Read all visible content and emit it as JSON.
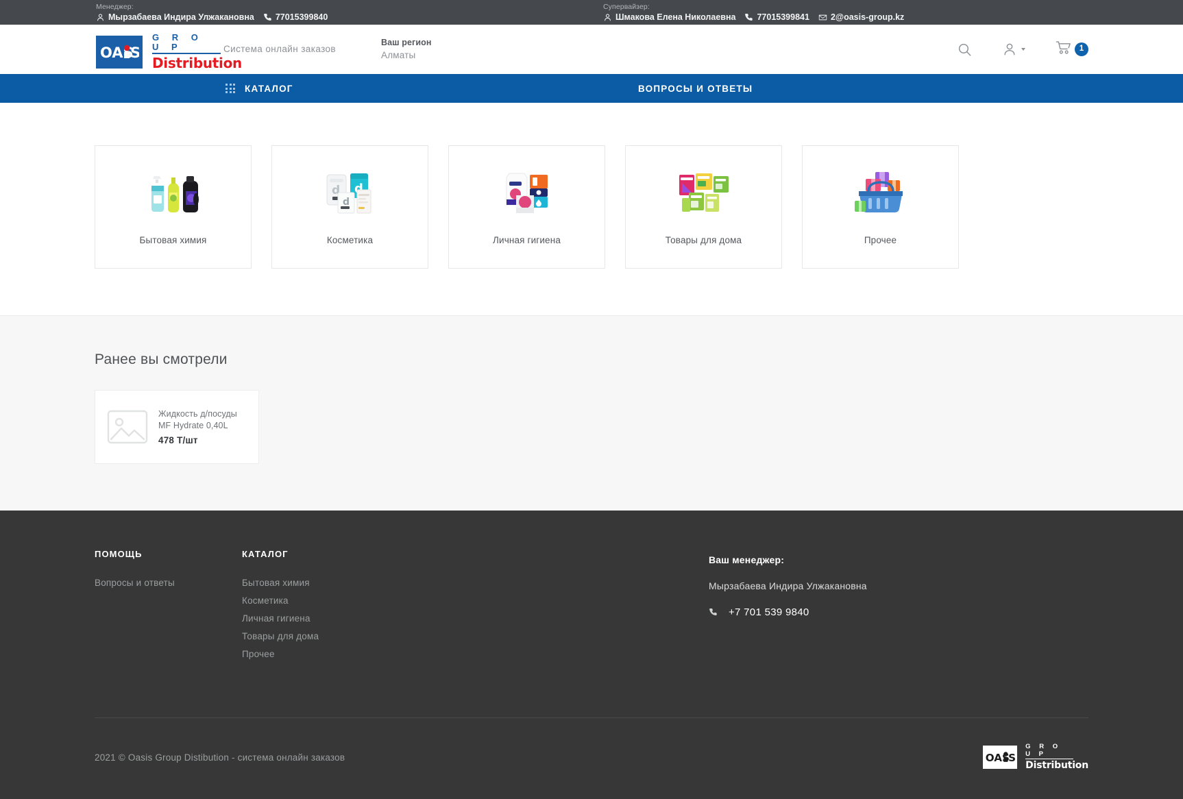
{
  "topbar": {
    "manager": {
      "role": "Менеджер:",
      "name": "Мырзабаева Индира Улжакановна",
      "phone": "77015399840",
      "person_icon": "person-icon",
      "phone_icon": "phone-icon"
    },
    "supervisor": {
      "role": "Супервайзер:",
      "name": "Шмакова Елена Николаевна",
      "phone": "77015399841",
      "email": "2@oasis-group.kz",
      "person_icon": "person-icon",
      "phone_icon": "phone-icon",
      "mail_icon": "mail-icon"
    }
  },
  "header": {
    "logo": {
      "mark_text": "OASIS",
      "group": "G R O U P",
      "distribution": "Distribution"
    },
    "tagline": "Система онлайн заказов",
    "region": {
      "label": "Ваш регион",
      "value": "Алматы"
    },
    "actions": {
      "search_icon": "search-icon",
      "account_icon": "user-icon",
      "cart_icon": "cart-icon",
      "cart_count": "1"
    }
  },
  "nav": {
    "catalog_label": "КАТАЛОГ",
    "catalog_icon": "grid-dots-icon",
    "faq_label": "ВОПРОСЫ И ОТВЕТЫ"
  },
  "categories": [
    {
      "title": "Бытовая химия",
      "icon": "household-chemicals-image"
    },
    {
      "title": "Косметика",
      "icon": "cosmetics-image"
    },
    {
      "title": "Личная гигиена",
      "icon": "personal-hygiene-image"
    },
    {
      "title": "Товары для дома",
      "icon": "home-goods-image"
    },
    {
      "title": "Прочее",
      "icon": "other-goods-image"
    }
  ],
  "recent": {
    "title": "Ранее вы смотрели",
    "products": [
      {
        "name": "Жидкость д/посуды MF Hydrate 0,40L",
        "price": "478 Т/шт",
        "thumb_icon": "image-placeholder-icon"
      }
    ]
  },
  "footer": {
    "help": {
      "heading": "ПОМОЩЬ",
      "links": [
        "Вопросы и ответы"
      ]
    },
    "catalog": {
      "heading": "КАТАЛОГ",
      "links": [
        "Бытовая химия",
        "Косметика",
        "Личная гигиена",
        "Товары для дома",
        "Прочее"
      ]
    },
    "manager": {
      "heading": "Ваш менеджер:",
      "name": "Мырзабаева Индира Улжакановна",
      "phone": "+7 701 539 9840",
      "phone_icon": "phone-icon"
    },
    "copyright": "2021 © Oasis Group Distibution - система онлайн заказов",
    "logo": {
      "mark_text": "OASIS",
      "group": "G R O U P",
      "distribution": "Distribution"
    }
  },
  "colors": {
    "topbar_bg": "#45484c",
    "nav_bg": "#0b5ca4",
    "brand_blue": "#1b5fa8",
    "brand_red": "#e31b23",
    "badge_blue": "#0f63ad",
    "footer_bg": "#373737"
  }
}
